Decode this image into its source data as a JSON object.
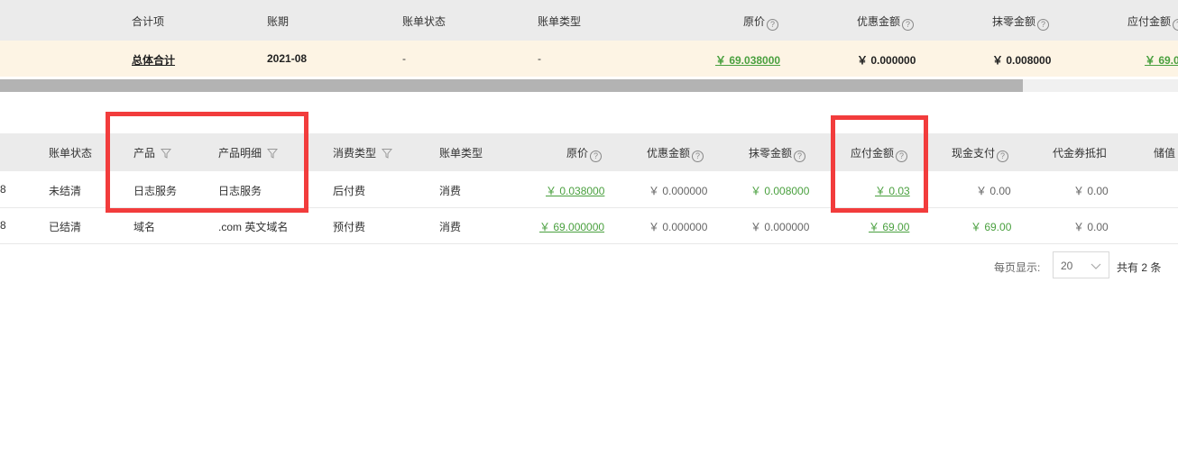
{
  "summary_table": {
    "headers": {
      "item": "合计项",
      "period": "账期",
      "bill_status": "账单状态",
      "bill_type": "账单类型",
      "original": "原价",
      "discount": "优惠金额",
      "rounding": "抹零金额",
      "payable": "应付金额"
    },
    "row": {
      "item": "总体合计",
      "period": "2021-08",
      "bill_status": "-",
      "bill_type": "-",
      "original": "￥ 69.038000",
      "discount": "￥ 0.000000",
      "rounding": "￥ 0.008000",
      "payable": "￥ 69.0"
    }
  },
  "detail_table": {
    "headers": {
      "bill_status": "账单状态",
      "product": "产品",
      "product_detail": "产品明细",
      "consumption_type": "消费类型",
      "bill_type": "账单类型",
      "original": "原价",
      "discount": "优惠金额",
      "rounding": "抹零金额",
      "payable": "应付金额",
      "cash": "现金支付",
      "voucher": "代金券抵扣",
      "stored": "储值"
    },
    "rows": [
      {
        "lead": "8",
        "bill_status": "未结清",
        "product": "日志服务",
        "product_detail": "日志服务",
        "consumption_type": "后付费",
        "bill_type": "消费",
        "original": "￥ 0.038000",
        "discount": "￥ 0.000000",
        "rounding": "￥ 0.008000",
        "payable": "￥ 0.03",
        "cash": "￥ 0.00",
        "voucher": "￥ 0.00"
      },
      {
        "lead": "8",
        "bill_status": "已结清",
        "product": "域名",
        "product_detail": ".com 英文域名",
        "consumption_type": "预付费",
        "bill_type": "消费",
        "original": "￥ 69.000000",
        "discount": "￥ 0.000000",
        "rounding": "￥ 0.000000",
        "payable": "￥ 69.00",
        "cash": "￥ 69.00",
        "voucher": "￥ 0.00"
      }
    ]
  },
  "pagination": {
    "per_page_label": "每页显示:",
    "per_page_value": "20",
    "total_text": "共有 2 条"
  },
  "colors": {
    "accent_green": "#4aa03f",
    "highlight_red": "#f23c3c",
    "summary_row_bg": "#fdf4e4"
  },
  "help_glyph": "?"
}
